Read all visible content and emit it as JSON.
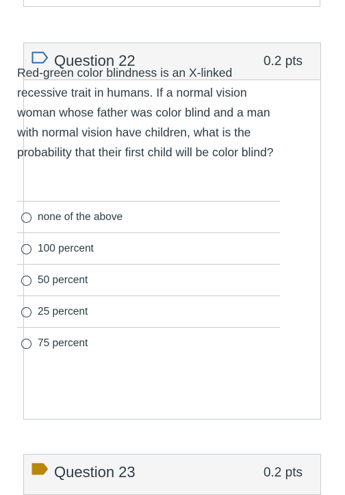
{
  "question": {
    "title": "Question 22",
    "points": "0.2 pts",
    "text": "Red-green color blindness is an X-linked recessive trait in humans. If a normal vision woman whose father was color blind and a man with normal vision have children, what is the probability that their first child will be color blind?",
    "answers": [
      {
        "label": "none of the above"
      },
      {
        "label": "100 percent"
      },
      {
        "label": "50 percent"
      },
      {
        "label": "25 percent"
      },
      {
        "label": "75 percent"
      }
    ]
  },
  "next_question": {
    "title": "Question 23",
    "points": "0.2 pts"
  },
  "colors": {
    "text": "#2d3b45",
    "border": "#c7cdd1",
    "header_bg": "#f5f5f5",
    "flag_outline": "#2b6cb0",
    "flag_filled": "#b7860b"
  },
  "icons": {
    "question_flag": "flag-outline-icon",
    "next_question_flag": "flag-filled-icon",
    "answer_radio": "radio-unchecked-icon"
  }
}
